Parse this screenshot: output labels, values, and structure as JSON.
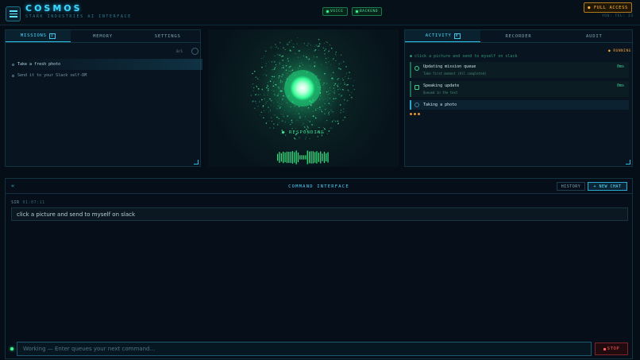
{
  "app": {
    "name": "COSMOS",
    "subtitle": "STARK INDUSTRIES AI INTERFACE",
    "status": [
      {
        "label": "VOICE",
        "color": "#3dff8e"
      },
      {
        "label": "BACKEND",
        "color": "#3dff8e"
      }
    ],
    "access_label": "● FULL ACCESS",
    "access_sub": "YOU: TEL: 23"
  },
  "left_panel": {
    "tabs": [
      {
        "label": "MISSIONS",
        "count": "1",
        "active": true
      },
      {
        "label": "MEMORY"
      },
      {
        "label": "SETTINGS"
      }
    ],
    "progress": "0/1",
    "missions": [
      {
        "label": "Take a fresh photo",
        "state": "active"
      },
      {
        "label": "Send it to your Slack self-DM",
        "state": "pending"
      }
    ]
  },
  "center": {
    "status": "● RESPONDING",
    "accent": "#3dff8e"
  },
  "right_panel": {
    "tabs": [
      {
        "label": "ACTIVITY",
        "count": "4",
        "active": true
      },
      {
        "label": "RECORDER"
      },
      {
        "label": "AUDIT"
      }
    ],
    "running": "● RUNNING",
    "command": "● click a picture and send to myself on slack",
    "items": [
      {
        "icon": "gear-icon",
        "title": "Updating mission queue",
        "sub": "Take first moment (All completed)",
        "time": "0ms"
      },
      {
        "icon": "chat-icon",
        "title": "Speaking update",
        "sub": "Queued in the text",
        "time": "0ms"
      },
      {
        "icon": "camera-icon",
        "title": "Taking a photo",
        "sub": "",
        "time": ""
      }
    ]
  },
  "command": {
    "collapse_glyph": "«",
    "title": "COMMAND INTERFACE",
    "history_label": "HISTORY",
    "new_chat_label": "+ NEW CHAT",
    "speaker": "SIR",
    "timestamp": "01:07:11",
    "message": "click a picture and send to myself on slack",
    "input_placeholder": "Working — Enter queues your next command...",
    "stop_label": "STOP"
  }
}
